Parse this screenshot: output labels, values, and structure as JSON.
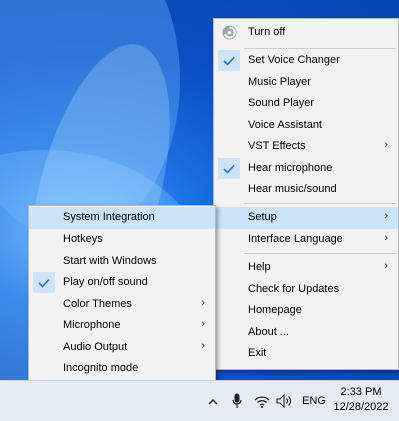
{
  "main_menu": {
    "items": [
      {
        "label": "Turn off",
        "icon": "power-swirl-icon"
      },
      {
        "label": "Set Voice Changer",
        "checked": true
      },
      {
        "label": "Music Player"
      },
      {
        "label": "Sound Player"
      },
      {
        "label": "Voice Assistant"
      },
      {
        "label": "VST Effects",
        "submenu": true
      },
      {
        "label": "Hear microphone",
        "checked": true
      },
      {
        "label": "Hear music/sound"
      },
      {
        "label": "Setup",
        "submenu": true,
        "highlighted": true
      },
      {
        "label": "Interface Language",
        "submenu": true
      },
      {
        "label": "Help",
        "submenu": true
      },
      {
        "label": "Check for Updates"
      },
      {
        "label": "Homepage"
      },
      {
        "label": "About ..."
      },
      {
        "label": "Exit"
      }
    ]
  },
  "setup_menu": {
    "items": [
      {
        "label": "System Integration",
        "highlighted": true
      },
      {
        "label": "Hotkeys"
      },
      {
        "label": "Start with Windows"
      },
      {
        "label": "Play on/off sound",
        "checked": true
      },
      {
        "label": "Color Themes",
        "submenu": true
      },
      {
        "label": "Microphone",
        "submenu": true
      },
      {
        "label": "Audio Output",
        "submenu": true
      },
      {
        "label": "Incognito mode"
      }
    ]
  },
  "taskbar": {
    "language": "ENG",
    "time": "2:33 PM",
    "date": "12/28/2022"
  },
  "colors": {
    "highlight": "#cce4f7",
    "checkmark": "#1a73e8",
    "menu_bg": "#f2f2f2"
  }
}
